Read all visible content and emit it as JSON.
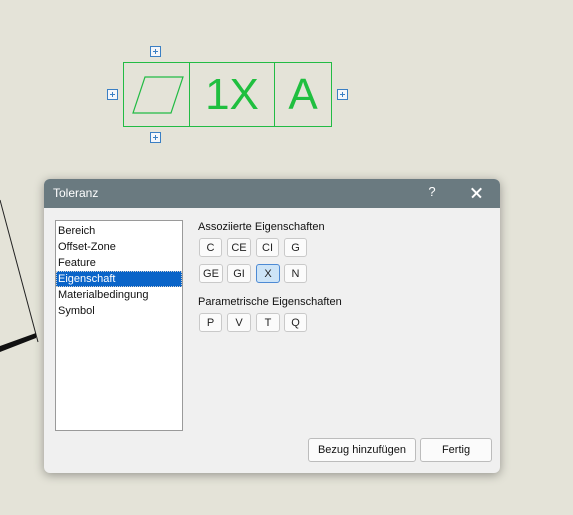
{
  "frame": {
    "value_text": "1X",
    "datum_text": "A",
    "color": "#22bb44"
  },
  "dialog": {
    "title": "Toleranz",
    "help_label": "?",
    "close_icon": "close-icon",
    "list_items": [
      "Bereich",
      "Offset-Zone",
      "Feature",
      "Eigenschaft",
      "Materialbedingung",
      "Symbol"
    ],
    "selected_item": "Eigenschaft",
    "associated": {
      "label": "Assoziierte Eigenschaften",
      "row1": [
        "C",
        "CE",
        "CI",
        "G"
      ],
      "row2": [
        "GE",
        "GI",
        "X",
        "N"
      ],
      "active": "X"
    },
    "parametric": {
      "label": "Parametrische Eigenschaften",
      "row": [
        "P",
        "V",
        "T",
        "Q"
      ]
    },
    "add_reference_label": "Bezug hinzufügen",
    "done_label": "Fertig",
    "accent_color": "#0a64c8"
  }
}
